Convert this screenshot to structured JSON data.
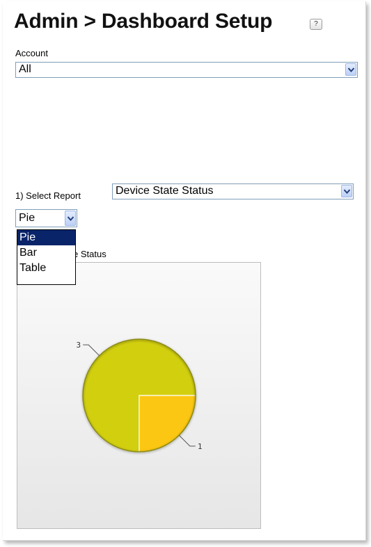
{
  "header": {
    "title": "Admin > Dashboard Setup",
    "help_icon": "question-mark-icon"
  },
  "account": {
    "label": "Account",
    "selected": "All"
  },
  "report": {
    "label": "1) Select Report",
    "selected": "Device State Status"
  },
  "chart_type": {
    "selected": "Pie",
    "options": [
      "Pie",
      "Bar",
      "Table"
    ],
    "highlighted": "Pie"
  },
  "chart_panel": {
    "title_visible": "e Status"
  },
  "colors": {
    "pie_large": "#d2cf0f",
    "pie_small": "#fcc712",
    "highlight": "#0a246a"
  },
  "chart_data": {
    "type": "pie",
    "title": "",
    "categories": [
      "",
      ""
    ],
    "values": [
      3,
      1
    ],
    "data_labels": [
      "3",
      "1"
    ]
  }
}
